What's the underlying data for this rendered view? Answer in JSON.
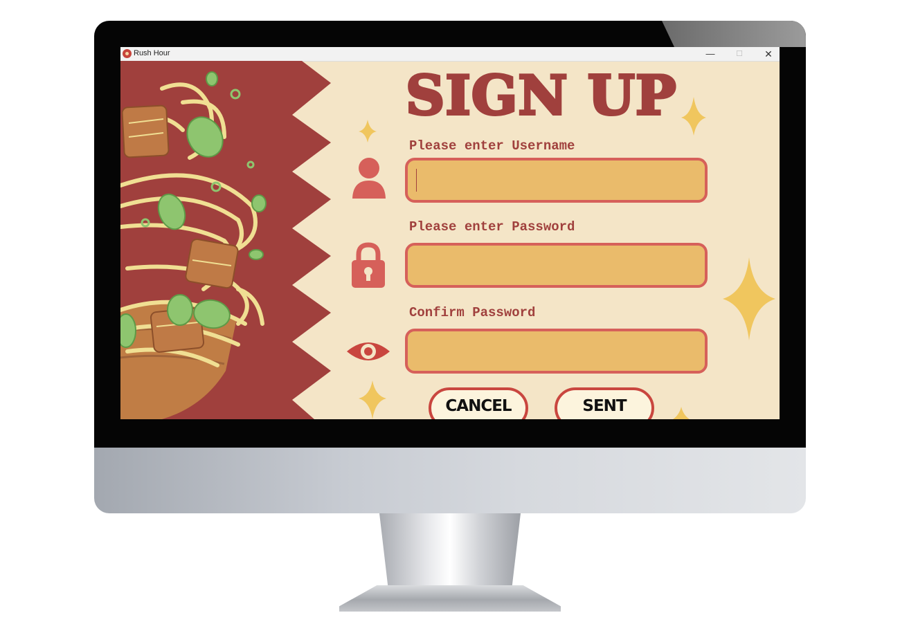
{
  "window": {
    "title": "Rush Hour",
    "controls": {
      "minimize": "—",
      "maximize": "☐",
      "close": "✕"
    }
  },
  "form": {
    "heading": "SIGN UP",
    "username": {
      "label": "Please enter Username",
      "value": "",
      "icon": "user-icon"
    },
    "password": {
      "label": "Please enter Password",
      "value": "",
      "icon": "lock-icon"
    },
    "confirm": {
      "label": "Confirm Password",
      "value": "",
      "icon": "eye-icon"
    },
    "buttons": {
      "cancel": "CANCEL",
      "sent": "SENT"
    }
  },
  "colors": {
    "background": "#f4e5c7",
    "accent": "#a0403d",
    "field_fill": "#eabb6b",
    "field_border": "#d6605a",
    "sparkle": "#f0c65e",
    "button_fill": "#fcf4dd"
  }
}
